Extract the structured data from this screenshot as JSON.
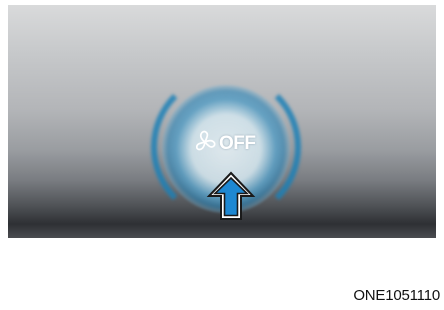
{
  "figure": {
    "button": {
      "icon": "fan-icon",
      "label": "OFF"
    },
    "indicator": {
      "icon": "up-arrow-icon",
      "color": "#1e88d2"
    },
    "glow_color": "#2a86be"
  },
  "caption": {
    "code": "ONE1051110"
  }
}
